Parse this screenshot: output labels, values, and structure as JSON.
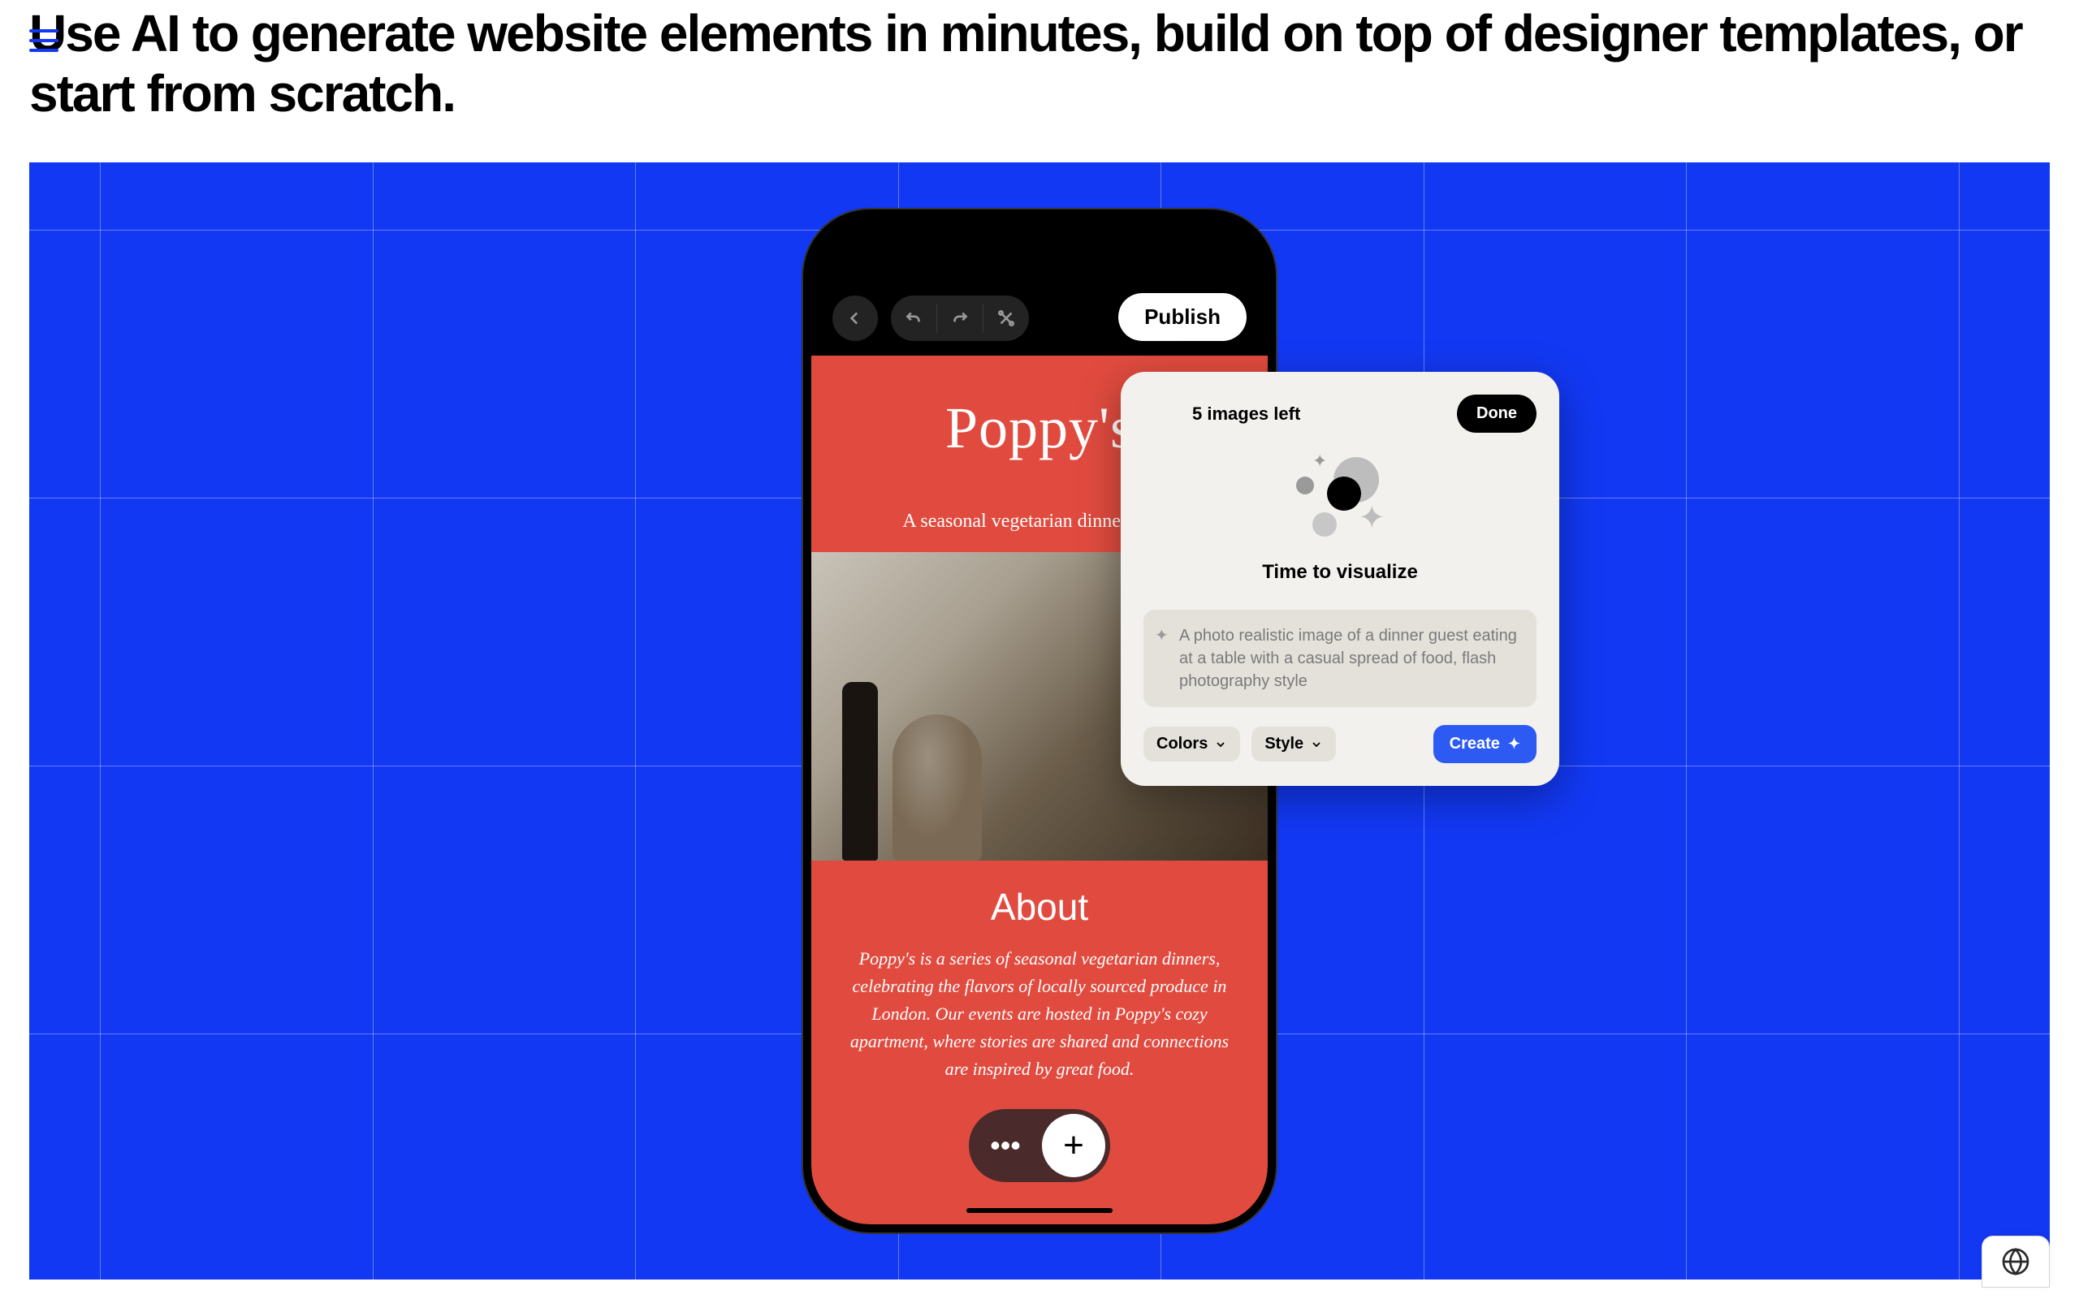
{
  "headline": "Use AI to generate website elements in minutes, build on top of designer templates, or start from scratch.",
  "toolbar": {
    "publish_label": "Publish"
  },
  "site": {
    "title": "Poppy's",
    "subtitle": "A seasonal vegetarian dinner series",
    "about_heading": "About",
    "about_body": "Poppy's is a series of seasonal vegetarian dinners, celebrating the flavors of locally sourced produce in London. Our events are hosted in Poppy's cozy apartment, where stories are shared and connections are inspired by great food."
  },
  "popup": {
    "counter": "5 images left",
    "done_label": "Done",
    "title": "Time to visualize",
    "prompt": "A photo realistic image of a dinner guest eating at a table with a casual spread of food, flash photography style",
    "colors_label": "Colors",
    "style_label": "Style",
    "create_label": "Create"
  }
}
